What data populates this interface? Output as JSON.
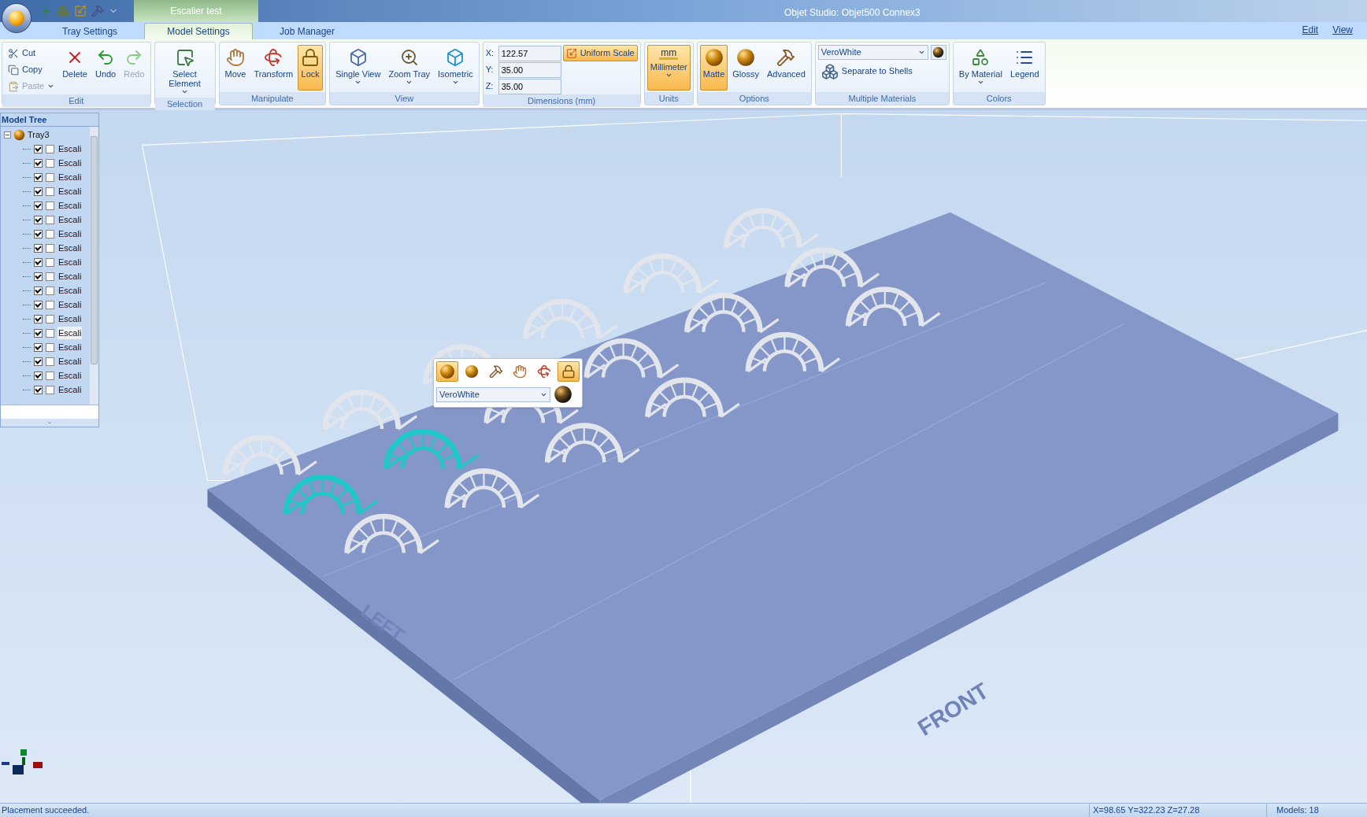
{
  "app": {
    "document_title": "Escalier test",
    "title": "Objet Studio: Objet500 Connex3"
  },
  "tabs": [
    {
      "label": "Tray Settings",
      "selected": false
    },
    {
      "label": "Model Settings",
      "selected": true
    },
    {
      "label": "Job Manager",
      "selected": false
    }
  ],
  "menu_right": [
    "Edit",
    "View"
  ],
  "ribbon": [
    {
      "title": "Edit",
      "items": [
        {
          "kind": "small",
          "label": "Cut",
          "selected": false,
          "disabled": false
        },
        {
          "kind": "small",
          "label": "Copy",
          "selected": false,
          "disabled": false
        },
        {
          "kind": "small",
          "label": "Paste",
          "selected": false,
          "disabled": true,
          "dropdown": true
        },
        {
          "kind": "large",
          "label": "Delete",
          "selected": false,
          "disabled": false
        },
        {
          "kind": "large",
          "label": "Undo",
          "selected": false,
          "disabled": false
        },
        {
          "kind": "large",
          "label": "Redo",
          "selected": false,
          "disabled": true
        }
      ]
    },
    {
      "title": "Selection",
      "items": [
        {
          "kind": "large",
          "label": "Select Element",
          "selected": false,
          "disabled": false,
          "dropdown": true
        }
      ]
    },
    {
      "title": "Manipulate",
      "items": [
        {
          "kind": "large",
          "label": "Move",
          "selected": false,
          "disabled": false
        },
        {
          "kind": "large",
          "label": "Transform",
          "selected": false,
          "disabled": false
        },
        {
          "kind": "large",
          "label": "Lock",
          "selected": true,
          "disabled": false
        }
      ]
    },
    {
      "title": "View",
      "items": [
        {
          "kind": "large",
          "label": "Single View",
          "selected": false,
          "disabled": false,
          "dropdown": true
        },
        {
          "kind": "large",
          "label": "Zoom Tray",
          "selected": false,
          "disabled": false,
          "dropdown": true
        },
        {
          "kind": "large",
          "label": "Isometric",
          "selected": false,
          "disabled": false,
          "dropdown": true
        }
      ]
    },
    {
      "title": "Dimensions (mm)",
      "items": [
        {
          "kind": "field",
          "label": "X:",
          "value": "122.57"
        },
        {
          "kind": "field",
          "label": "Y:",
          "value": "35.00"
        },
        {
          "kind": "field",
          "label": "Z:",
          "value": "35.00"
        },
        {
          "kind": "small",
          "label": "Uniform Scale",
          "selected": true,
          "disabled": false
        }
      ]
    },
    {
      "title": "Units",
      "items": [
        {
          "kind": "large",
          "label": "Millimeter",
          "icon_text": "mm",
          "selected": true,
          "disabled": false,
          "dropdown": true
        }
      ]
    },
    {
      "title": "Options",
      "items": [
        {
          "kind": "large",
          "label": "Matte",
          "selected": true,
          "disabled": false
        },
        {
          "kind": "large",
          "label": "Glossy",
          "selected": false,
          "disabled": false
        },
        {
          "kind": "large",
          "label": "Advanced",
          "selected": false,
          "disabled": false
        }
      ]
    },
    {
      "title": "Multiple Materials",
      "items": [
        {
          "kind": "combo",
          "value": "VeroWhite"
        },
        {
          "kind": "small",
          "label": "Separate to Shells",
          "selected": false,
          "disabled": false
        }
      ]
    },
    {
      "title": "Colors",
      "items": [
        {
          "kind": "large",
          "label": "By Material",
          "selected": false,
          "disabled": false,
          "dropdown": true
        },
        {
          "kind": "large",
          "label": "Legend",
          "selected": false,
          "disabled": false
        }
      ]
    }
  ],
  "model_tree": {
    "title": "Model Tree",
    "root": {
      "label": "Tray3",
      "expanded": true,
      "children": [
        {
          "label": "Escali",
          "checked": true,
          "marked": false,
          "selected": false
        },
        {
          "label": "Escali",
          "checked": true,
          "marked": false,
          "selected": false
        },
        {
          "label": "Escali",
          "checked": true,
          "marked": false,
          "selected": false
        },
        {
          "label": "Escali",
          "checked": true,
          "marked": false,
          "selected": false
        },
        {
          "label": "Escali",
          "checked": true,
          "marked": false,
          "selected": false
        },
        {
          "label": "Escali",
          "checked": true,
          "marked": false,
          "selected": false
        },
        {
          "label": "Escali",
          "checked": true,
          "marked": false,
          "selected": false
        },
        {
          "label": "Escali",
          "checked": true,
          "marked": false,
          "selected": false
        },
        {
          "label": "Escali",
          "checked": true,
          "marked": false,
          "selected": false
        },
        {
          "label": "Escali",
          "checked": true,
          "marked": false,
          "selected": false
        },
        {
          "label": "Escali",
          "checked": true,
          "marked": false,
          "selected": false
        },
        {
          "label": "Escali",
          "checked": true,
          "marked": false,
          "selected": false
        },
        {
          "label": "Escali",
          "checked": true,
          "marked": false,
          "selected": false
        },
        {
          "label": "Escali",
          "checked": true,
          "marked": false,
          "selected": true
        },
        {
          "label": "Escali",
          "checked": true,
          "marked": false,
          "selected": false
        },
        {
          "label": "Escali",
          "checked": true,
          "marked": false,
          "selected": false
        },
        {
          "label": "Escali",
          "checked": true,
          "marked": false,
          "selected": false
        },
        {
          "label": "Escali",
          "checked": true,
          "marked": false,
          "selected": false
        }
      ]
    }
  },
  "tray_labels": [
    "LEFT",
    "FRONT"
  ],
  "mini_toolbar": {
    "buttons": [
      {
        "selected": true
      },
      {
        "selected": false
      },
      {
        "selected": false
      },
      {
        "selected": false
      },
      {
        "selected": false
      },
      {
        "selected": true
      }
    ],
    "material": "VeroWhite"
  },
  "status_bar": {
    "message": "Placement succeeded.",
    "coordinates": "X=98.65 Y=322.23 Z=27.28",
    "models": "Models: 18"
  }
}
